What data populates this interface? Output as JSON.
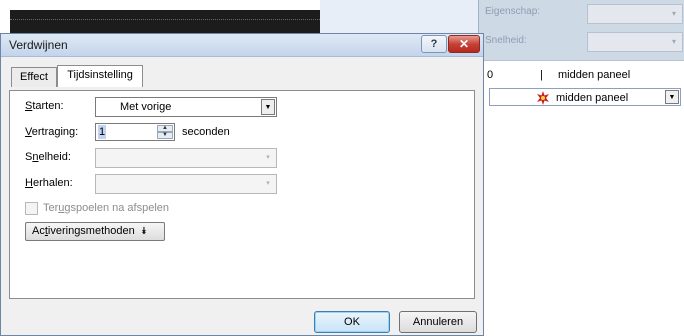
{
  "background": {
    "eigenschap_label": "Eigenschap:",
    "snelheid_label": "Snelheid:",
    "list": [
      {
        "index": "0",
        "marker": "|",
        "label": "midden paneel"
      },
      {
        "index": "",
        "marker": "",
        "label": "midden paneel"
      }
    ],
    "combo_arrow": "▾",
    "item_dropdown_arrow": "▼"
  },
  "dialog": {
    "title": "Verdwijnen",
    "help_glyph": "?",
    "close_glyph": "✕",
    "tabs": [
      {
        "label": "Effect",
        "active": false
      },
      {
        "label": "Tijdsinstelling",
        "active": true
      }
    ],
    "starten": {
      "prefix": "",
      "accel": "S",
      "rest": "tarten:",
      "value": "Met vorige",
      "arrow": "▼"
    },
    "vertraging": {
      "accel": "V",
      "rest": "ertraging:",
      "value": "1",
      "unit": "seconden",
      "up": "▲",
      "down": "▼"
    },
    "snelheid": {
      "pre": "S",
      "accel": "n",
      "rest": "elheid:",
      "arrow": "▾"
    },
    "herhalen": {
      "accel": "H",
      "rest": "erhalen:",
      "arrow": "▾"
    },
    "terugspoelen": {
      "pre": "Ter",
      "accel": "u",
      "rest": "gspoelen na afspelen",
      "checked": false
    },
    "activering": {
      "pre": "Ac",
      "accel": "t",
      "rest": "iveringsmethoden",
      "icon": "⯯"
    },
    "ok_label": "OK",
    "cancel_label": "Annuleren"
  },
  "colors": {
    "accent_blue": "#3c7fb1",
    "close_red": "#c7423a",
    "pane_header": "#ced9e6",
    "animation_icon": "#c81e1e"
  }
}
